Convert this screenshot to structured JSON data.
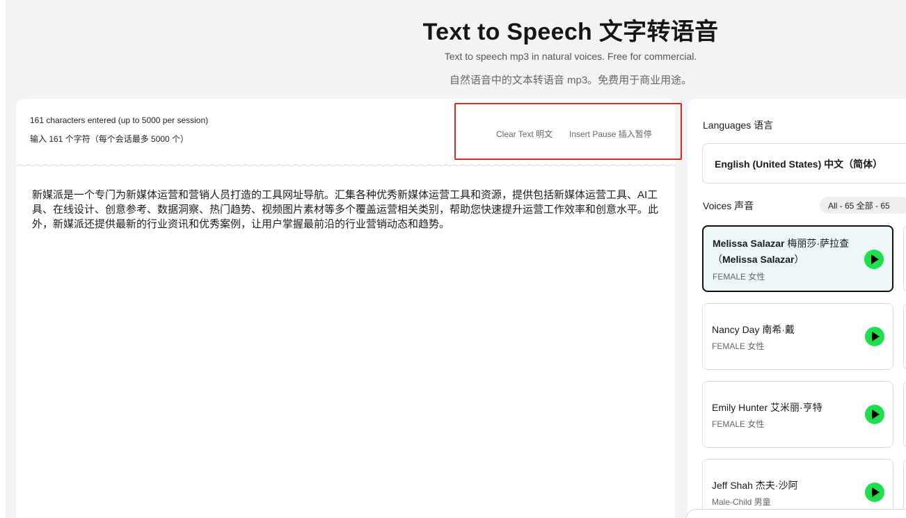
{
  "header": {
    "title": "Text to Speech  文字转语音",
    "subtitle_en": "Text to speech mp3 in natural voices. Free for commercial.",
    "subtitle_zh": "自然语音中的文本转语音 mp3。免费用于商业用途。"
  },
  "editor": {
    "char_count_en": "161 characters entered (up to 5000 per session)",
    "char_count_zh": "输入 161 个字符（每个会话最多 5000 个）",
    "clear_text_label": "Clear Text 明文",
    "insert_pause_label": "Insert Pause  插入暂停",
    "content": "新媒派是一个专门为新媒体运营和营销人员打造的工具网址导航。汇集各种优秀新媒体运营工具和资源，提供包括新媒体运营工具、AI工具、在线设计、创意参考、数据洞察、热门趋势、视频图片素材等多个覆盖运营相关类别，帮助您快速提升运营工作效率和创意水平。此外，新媒派还提供最新的行业资讯和优秀案例，让用户掌握最前沿的行业营销动态和趋势。"
  },
  "languages": {
    "label": "Languages 语言",
    "selected": "English (United States) 中文（简体）"
  },
  "voices": {
    "label": "Voices 声音",
    "filter": "All - 65  全部 - 65",
    "items": [
      {
        "name_bold": "Melissa Salazar",
        "name_rest": " 梅丽莎·萨拉查（",
        "name_bold2": "Melissa Salazar",
        "name_end": "）",
        "tag": "FEMALE 女性"
      },
      {
        "name": "Nancy Day 南希·戴",
        "tag": "FEMALE 女性"
      },
      {
        "name": "Emily Hunter 艾米丽·亨特",
        "tag": "FEMALE 女性"
      },
      {
        "name": "Jeff Shah 杰夫·沙阿",
        "tag": "Male-Child 男童"
      }
    ]
  },
  "colors": {
    "accent_green": "#1ee04e",
    "highlight_red": "#e5241c",
    "selected_bg": "#eef7f8"
  },
  "icons": [
    "play-icon"
  ]
}
